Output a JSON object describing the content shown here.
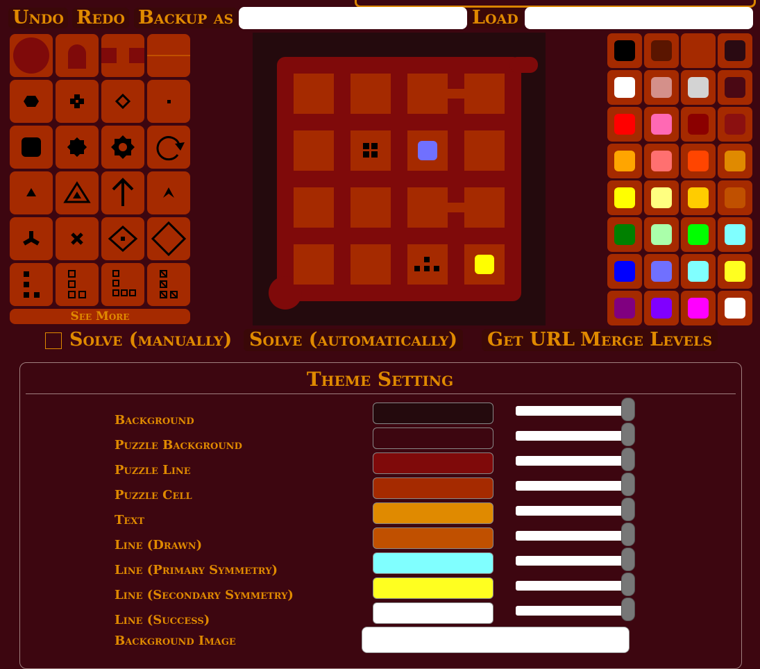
{
  "toolbar": {
    "undo": "Undo",
    "redo": "Redo",
    "backup_as": "Backup as",
    "backup_value": "",
    "load": "Load",
    "load_value": ""
  },
  "symbols": {
    "see_more": "See More",
    "items": [
      "circle-start-icon",
      "end-cap-icon",
      "gap-icon",
      "missing-line-icon",
      "hexagon-dot-icon",
      "cross-icon",
      "diamond-small-icon",
      "dot-small-icon",
      "square-icon",
      "star-icon",
      "gear-icon",
      "rotate-icon",
      "triangle-icon",
      "triangle-outline-icon",
      "arrow-up-icon",
      "chevron-up-icon",
      "tri-star-icon",
      "x-icon",
      "diamond-dot-icon",
      "diamond-large-icon",
      "polyomino-icon",
      "polyomino-outline-icon",
      "polyomino-outline-large-icon",
      "polyomino-negative-icon"
    ]
  },
  "palette": [
    "#000000",
    "#5a1500",
    "#a52a00",
    "#2a0a12",
    "#ffffff",
    "#d4908a",
    "#d3d3d3",
    "#4a0814",
    "#ff0000",
    "#ff69b4",
    "#8b0000",
    "#8b1010",
    "#ffa500",
    "#ff7070",
    "#ff4500",
    "#e08a00",
    "#ffff00",
    "#ffff80",
    "#ffcc00",
    "#c05000",
    "#008000",
    "#aaffaa",
    "#00ff00",
    "#80ffff",
    "#0000ff",
    "#7070ff",
    "#80ffff",
    "#ffff20",
    "#800080",
    "#8000ff",
    "#ff00ff",
    "#ffffff"
  ],
  "actions": {
    "solve_manually": "Solve (manually)",
    "solve_auto": "Solve (automatically)",
    "get_url": "Get URL",
    "merge_levels": "Merge Levels"
  },
  "theme": {
    "title": "Theme Setting",
    "rows": [
      {
        "label": "Background",
        "color": "#240a0d"
      },
      {
        "label": "Puzzle Background",
        "color": "#3d0610"
      },
      {
        "label": "Puzzle Line",
        "color": "#7f0a0a"
      },
      {
        "label": "Puzzle Cell",
        "color": "#a52a00"
      },
      {
        "label": "Text",
        "color": "#e08a00"
      },
      {
        "label": "Line (Drawn)",
        "color": "#c05000"
      },
      {
        "label": "Line (Primary Symmetry)",
        "color": "#80ffff"
      },
      {
        "label": "Line (Secondary Symmetry)",
        "color": "#ffff20"
      },
      {
        "label": "Line (Success)",
        "color": "#ffffff"
      }
    ],
    "background_image_label": "Background Image",
    "background_image_value": ""
  }
}
